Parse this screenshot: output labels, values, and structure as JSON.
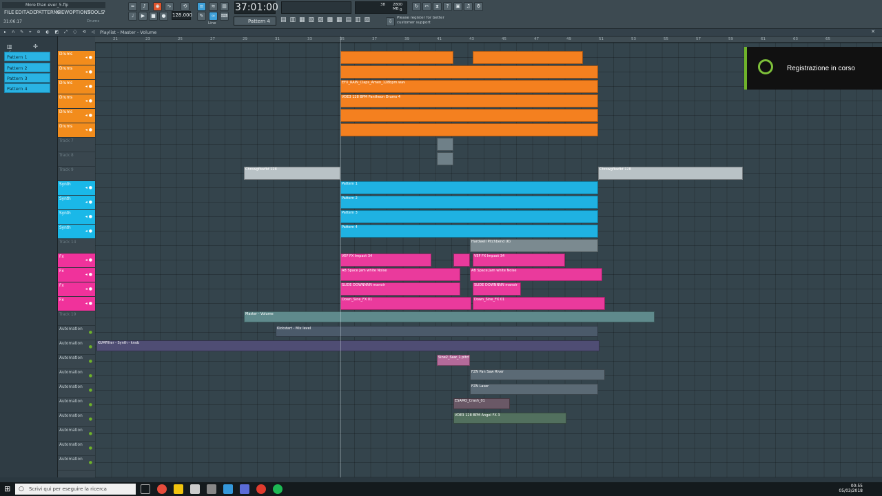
{
  "window": {
    "title": "More than ever_5.flp",
    "time": "31:06:17",
    "channel_hint": "Drums"
  },
  "menu": [
    "FILE",
    "EDIT",
    "ADD",
    "PATTERNS",
    "VIEW",
    "OPTIONS",
    "TOOLS",
    "?"
  ],
  "transport": {
    "tempo": "128.000",
    "position": "37:01:00",
    "pattern": "Pattern 4",
    "snap": "Line",
    "cpu": "38",
    "ram": "2800 MB",
    "voices": "0"
  },
  "notice": "Please register for better customer support",
  "playlist": {
    "breadcrumb": "Playlist - Master - Volume"
  },
  "ruler": [
    "21",
    "23",
    "25",
    "27",
    "29",
    "31",
    "33",
    "35",
    "37",
    "39",
    "41",
    "43",
    "45",
    "47",
    "49",
    "51",
    "53",
    "55",
    "57",
    "59",
    "61",
    "63",
    "65"
  ],
  "patterns": [
    "Pattern 1",
    "Pattern 2",
    "Pattern 3",
    "Pattern 4"
  ],
  "tracks": [
    {
      "name": "Drums",
      "color": "#f28c1c"
    },
    {
      "name": "Drums",
      "color": "#f28c1c"
    },
    {
      "name": "Drums",
      "color": "#f28c1c"
    },
    {
      "name": "Drums",
      "color": "#f28c1c"
    },
    {
      "name": "Drums",
      "color": "#f28c1c"
    },
    {
      "name": "Drums",
      "color": "#f28c1c"
    },
    {
      "name": "Track 7",
      "color": ""
    },
    {
      "name": "Track 8",
      "color": ""
    },
    {
      "name": "Track 9",
      "color": ""
    },
    {
      "name": "Synth",
      "color": "#1ab8e8"
    },
    {
      "name": "Synth",
      "color": "#1ab8e8"
    },
    {
      "name": "Synth",
      "color": "#1ab8e8"
    },
    {
      "name": "Synth",
      "color": "#1ab8e8"
    },
    {
      "name": "Track 14",
      "color": ""
    },
    {
      "name": "Fx",
      "color": "#f0329b"
    },
    {
      "name": "Fx",
      "color": "#f0329b"
    },
    {
      "name": "Fx",
      "color": "#f0329b"
    },
    {
      "name": "Fx",
      "color": "#f0329b"
    },
    {
      "name": "Track 19",
      "color": ""
    },
    {
      "name": "Automation",
      "color": ""
    },
    {
      "name": "Automation",
      "color": ""
    },
    {
      "name": "Automation",
      "color": ""
    },
    {
      "name": "Automation",
      "color": ""
    },
    {
      "name": "Automation",
      "color": ""
    },
    {
      "name": "Automation",
      "color": ""
    },
    {
      "name": "Automation",
      "color": ""
    },
    {
      "name": "Automation",
      "color": ""
    },
    {
      "name": "Automation",
      "color": ""
    },
    {
      "name": "Automation",
      "color": ""
    }
  ],
  "clips": {
    "efx": "EFX_RAIN_Claps_Amen_128bpm.wav",
    "vdes": "VDE3 128 BPM Pantheon Drums 4",
    "chrow": "Chrowgfbwfbf 128",
    "hardwell": "Hardwell Pitchbend (6)",
    "vef": "VEF FX Impact 34",
    "space": "AB Space Jam white Noise",
    "slide": "SLIDE DOWNNNN manoir",
    "down": "Down_Sine_FX 01",
    "master": "Master - Volume",
    "kick": "Kickstart - Mix level",
    "synthknob": "KUMFilter - Synth - knob",
    "sine": "Sine2_Saw_1 pitch",
    "fzn": "FZN Pan Saw River",
    "laser": "FZN Laser",
    "esamo": "ESAMO_Crash_01",
    "angel": "VDE3 128 BPM Angel FX 3"
  },
  "notification": {
    "text": "Registrazione in corso"
  },
  "taskbar": {
    "search": "Scrivi qui per eseguire la ricerca",
    "clock": "00:55",
    "date": "05/03/2018"
  }
}
